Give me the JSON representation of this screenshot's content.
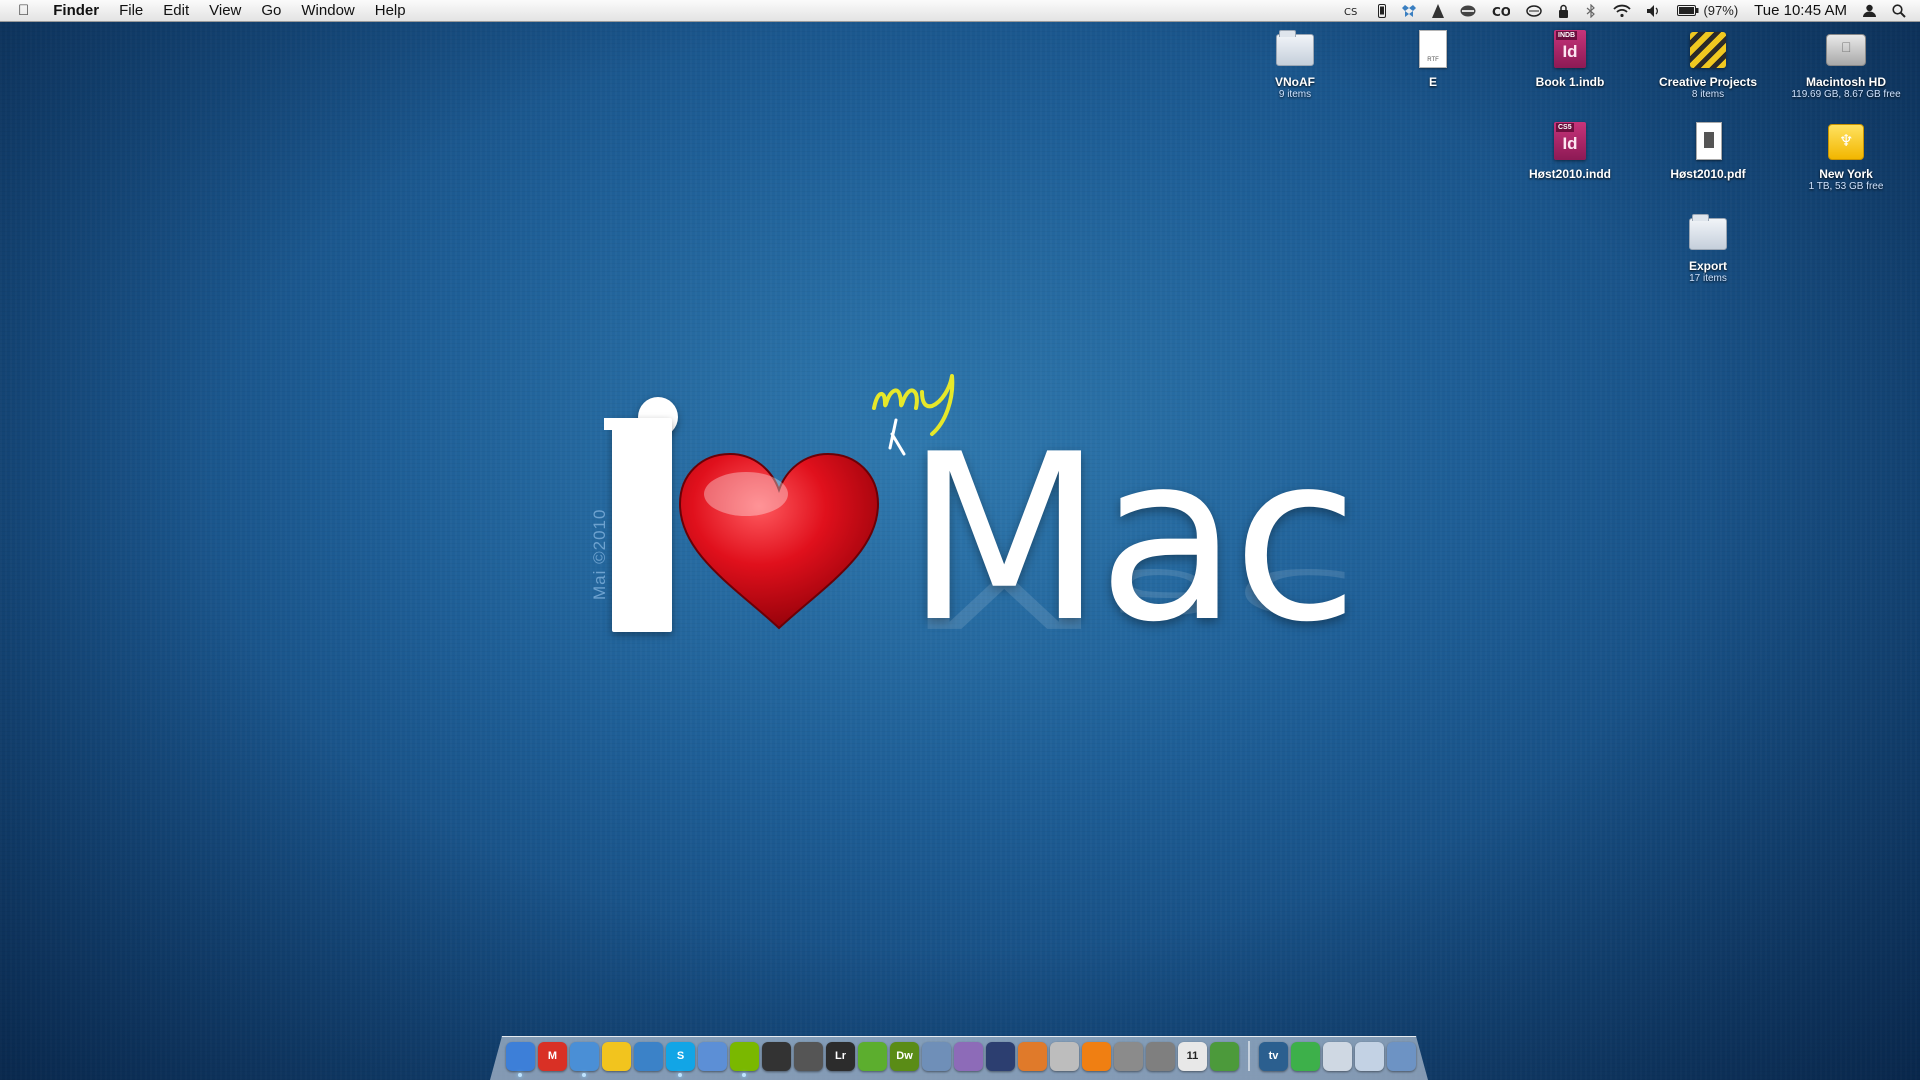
{
  "menubar": {
    "apple_glyph": "",
    "app_name": "Finder",
    "menus": [
      "File",
      "Edit",
      "View",
      "Go",
      "Window",
      "Help"
    ],
    "status": {
      "battery_text": "(97%)",
      "clock": "Tue 10:45 AM"
    },
    "status_icons": [
      "creative-suite-icon",
      "iphone-icon",
      "dropbox-icon",
      "growl-icon",
      "cc-icon",
      "time-machine-icon",
      "lock-icon",
      "bluetooth-icon",
      "wifi-icon",
      "volume-icon",
      "battery-icon",
      "user-icon",
      "spotlight-icon"
    ]
  },
  "desktop_icons": [
    {
      "name": "VNoAF",
      "sub": "9 items",
      "kind": "folder"
    },
    {
      "name": "E",
      "sub": "",
      "kind": "rtf-document",
      "tag": "RTF"
    },
    {
      "name": "Book 1.indb",
      "sub": "",
      "kind": "indesign-book",
      "tag": "INDB",
      "glyph": "Id"
    },
    {
      "name": "Creative Projects",
      "sub": "8 items",
      "kind": "striped-folder"
    },
    {
      "name": "Macintosh HD",
      "sub": "119.69 GB, 8.67 GB free",
      "kind": "hard-drive"
    },
    {
      "name": "Høst2010.indd",
      "sub": "",
      "kind": "indesign-document",
      "tag": "CS5",
      "glyph": "Id"
    },
    {
      "name": "Høst2010.pdf",
      "sub": "",
      "kind": "pdf-document"
    },
    {
      "name": "New York",
      "sub": "1 TB, 53 GB free",
      "kind": "network-drive"
    },
    {
      "name": "Export",
      "sub": "17 items",
      "kind": "folder"
    }
  ],
  "wallpaper": {
    "credit": "Mai ©2010",
    "mac_word": "Mac",
    "scribble_text": "my",
    "heart_color": "#e0101c",
    "scribble_color": "#e6e82a"
  },
  "dock": {
    "items": [
      {
        "name": "finder",
        "label": "",
        "color": "#3d7fd8",
        "running": true
      },
      {
        "name": "gmail",
        "label": "M",
        "color": "#d93025",
        "running": false
      },
      {
        "name": "safari",
        "label": "",
        "color": "#4a8fd6",
        "running": true
      },
      {
        "name": "adium",
        "label": "",
        "color": "#f2c41e",
        "running": false
      },
      {
        "name": "facetime",
        "label": "",
        "color": "#3b82c8",
        "running": false
      },
      {
        "name": "skype",
        "label": "S",
        "color": "#12a5e6",
        "running": true
      },
      {
        "name": "itunes",
        "label": "",
        "color": "#5c8fd6",
        "running": false
      },
      {
        "name": "spotify",
        "label": "",
        "color": "#7ab800",
        "running": true
      },
      {
        "name": "aperture",
        "label": "",
        "color": "#333333",
        "running": false
      },
      {
        "name": "final-cut",
        "label": "",
        "color": "#555555",
        "running": false
      },
      {
        "name": "lightroom",
        "label": "Lr",
        "color": "#2c2c2c",
        "running": false
      },
      {
        "name": "coda",
        "label": "",
        "color": "#5cae2e",
        "running": false
      },
      {
        "name": "dreamweaver",
        "label": "Dw",
        "color": "#5a8c16",
        "running": false
      },
      {
        "name": "flickr-uploadr",
        "label": "",
        "color": "#6f8fb8",
        "running": false
      },
      {
        "name": "packages",
        "label": "",
        "color": "#8d6bb8",
        "running": false
      },
      {
        "name": "xcode",
        "label": "",
        "color": "#2c3e70",
        "running": false
      },
      {
        "name": "notes",
        "label": "",
        "color": "#e07a2a",
        "running": false
      },
      {
        "name": "scanner",
        "label": "",
        "color": "#bdbdbd",
        "running": false
      },
      {
        "name": "vlc",
        "label": "",
        "color": "#f07f12",
        "running": false
      },
      {
        "name": "automator",
        "label": "",
        "color": "#8b8b8b",
        "running": false
      },
      {
        "name": "system-preferences",
        "label": "",
        "color": "#7f7f7f",
        "running": false
      },
      {
        "name": "ical",
        "label": "11",
        "color": "#e8e8e8",
        "running": false
      },
      {
        "name": "money",
        "label": "",
        "color": "#4c9a3b",
        "running": false
      }
    ],
    "stack_items": [
      {
        "name": "eyetv",
        "label": "tv",
        "color": "#2b5f8f"
      },
      {
        "name": "downloads",
        "label": "",
        "color": "#3db04a"
      },
      {
        "name": "documents",
        "label": "",
        "color": "#cfd8e3"
      },
      {
        "name": "applications-folder",
        "label": "",
        "color": "#c3d2e4"
      },
      {
        "name": "trash",
        "label": "",
        "color": "#6d93c4"
      }
    ]
  }
}
